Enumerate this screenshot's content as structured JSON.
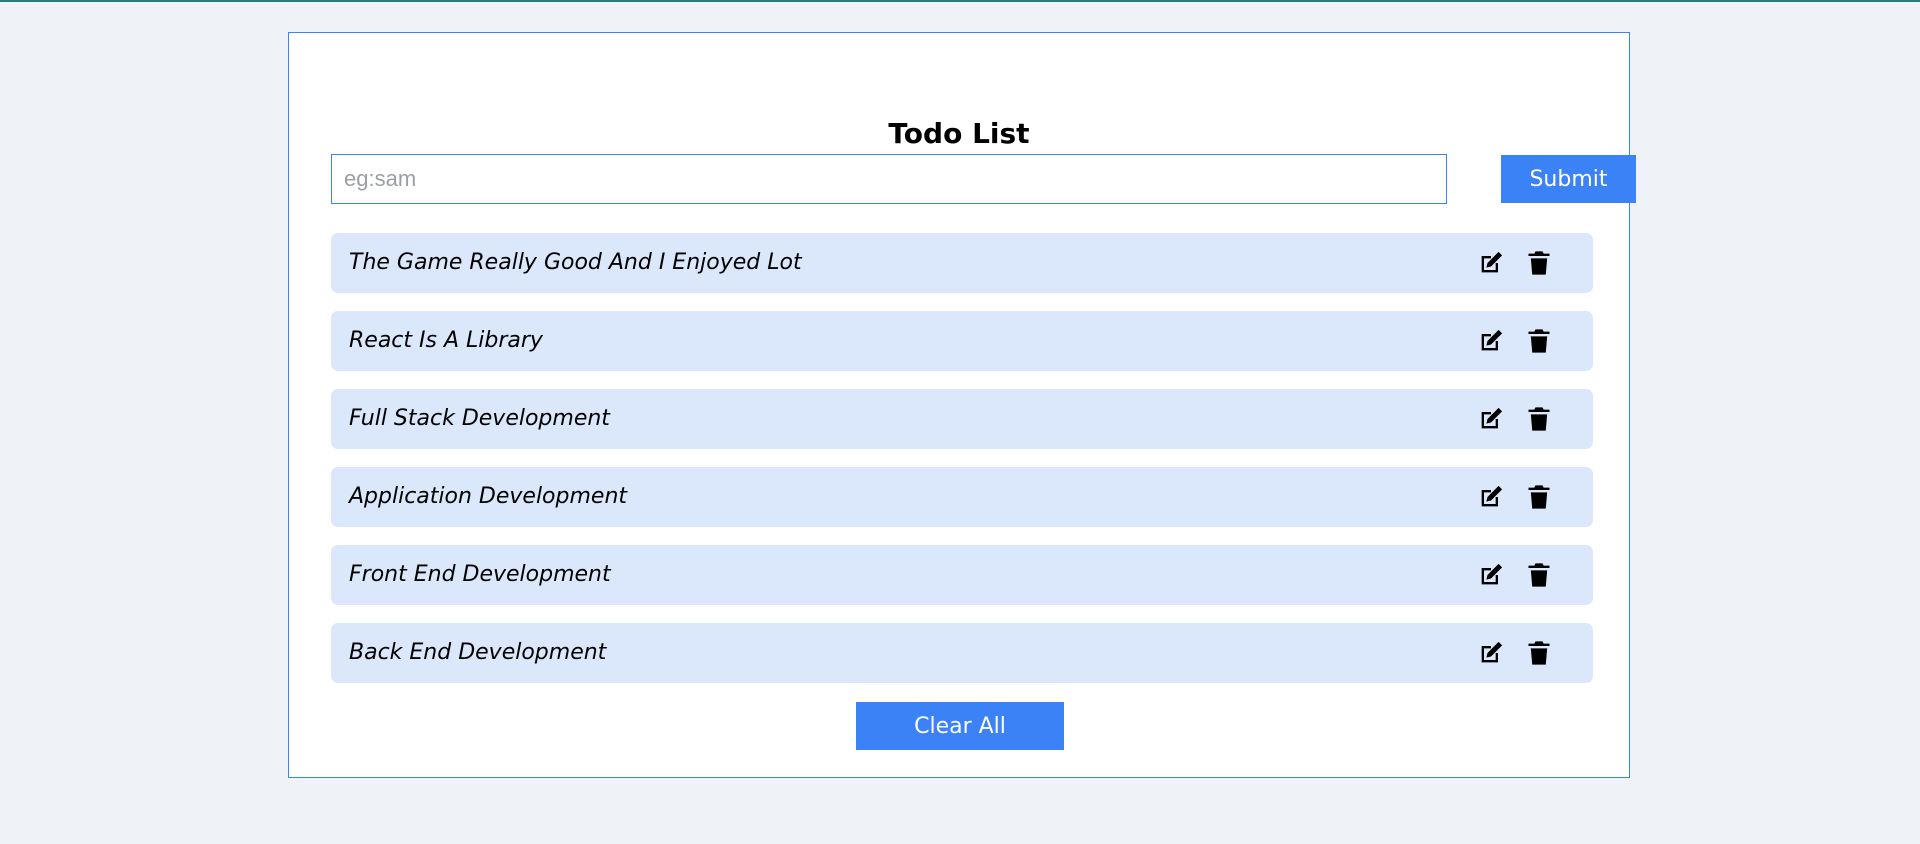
{
  "app": {
    "title": "Todo List"
  },
  "form": {
    "input_value": "",
    "input_placeholder": "eg:sam",
    "submit_label": "Submit"
  },
  "todos": [
    {
      "text": "The Game Really Good And I Enjoyed Lot",
      "edit_icon": "edit-icon",
      "delete_icon": "trash-icon"
    },
    {
      "text": "React Is A Library",
      "edit_icon": "edit-icon",
      "delete_icon": "trash-icon"
    },
    {
      "text": "Full Stack Development",
      "edit_icon": "edit-icon",
      "delete_icon": "trash-icon"
    },
    {
      "text": "Application Development",
      "edit_icon": "edit-icon",
      "delete_icon": "trash-icon"
    },
    {
      "text": "Front End Development",
      "edit_icon": "edit-icon",
      "delete_icon": "trash-icon"
    },
    {
      "text": "Back End Development",
      "edit_icon": "edit-icon",
      "delete_icon": "trash-icon"
    }
  ],
  "actions": {
    "clear_all_label": "Clear All"
  },
  "colors": {
    "page_background": "#eff3f8",
    "accent": "#3b82f6",
    "item_background": "#dbe8fc",
    "card_background": "#ffffff"
  }
}
